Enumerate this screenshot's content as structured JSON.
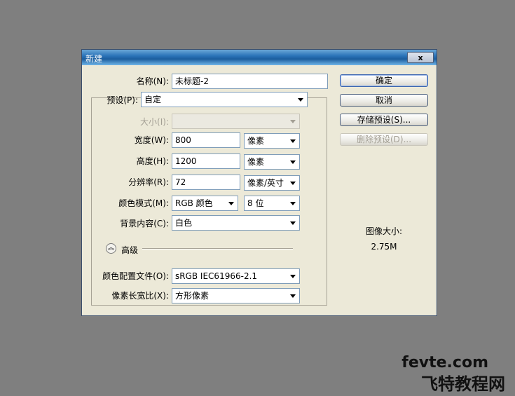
{
  "window": {
    "title": "新建",
    "close_label": "x"
  },
  "fields": {
    "name": {
      "label": "名称(N):",
      "value": "未标题-2"
    },
    "preset": {
      "label": "预设(P):",
      "value": "自定"
    },
    "size": {
      "label": "大小(I):",
      "value": ""
    },
    "width": {
      "label": "宽度(W):",
      "value": "800",
      "unit": "像素"
    },
    "height": {
      "label": "高度(H):",
      "value": "1200",
      "unit": "像素"
    },
    "resolution": {
      "label": "分辨率(R):",
      "value": "72",
      "unit": "像素/英寸"
    },
    "color_mode": {
      "label": "颜色模式(M):",
      "value": "RGB 颜色",
      "depth": "8 位"
    },
    "background": {
      "label": "背景内容(C):",
      "value": "白色"
    },
    "advanced": {
      "label": "高级"
    },
    "color_profile": {
      "label": "颜色配置文件(O):",
      "value": "sRGB IEC61966-2.1"
    },
    "pixel_aspect": {
      "label": "像素长宽比(X):",
      "value": "方形像素"
    }
  },
  "buttons": {
    "ok": "确定",
    "cancel": "取消",
    "save_preset": "存储预设(S)...",
    "delete_preset": "删除预设(D)..."
  },
  "image_size": {
    "label": "图像大小:",
    "value": "2.75M"
  },
  "watermark": {
    "line1": "fevte.com",
    "line2": "飞特教程网"
  }
}
